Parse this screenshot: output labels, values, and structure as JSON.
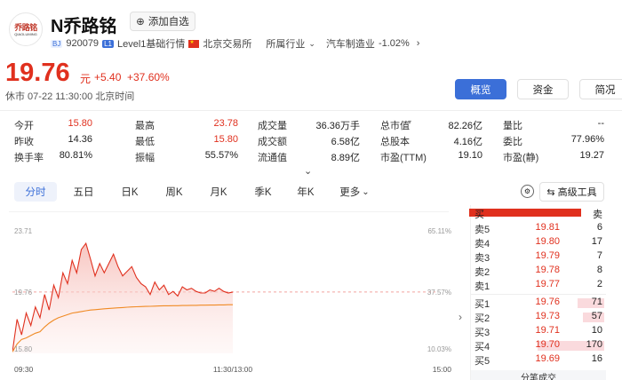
{
  "header": {
    "logo_text_cn": "乔路铭",
    "logo_text_en": "QIAOLUMING",
    "stock_name": "N乔路铭",
    "watch_label": "添加自选",
    "exchange_tag": "BJ",
    "code": "920079",
    "level_tag": "L1",
    "level_label": "Level1基础行情",
    "exchange_name": "北京交易所",
    "industry_label": "所属行业",
    "industry_name": "汽车制造业",
    "industry_change": "-1.02%"
  },
  "quote": {
    "price": "19.76",
    "unit": "元",
    "change": "+5.40",
    "change_pct": "+37.60%",
    "status": "休市 07-22 11:30:00 北京时间"
  },
  "tabs": [
    "概览",
    "资金",
    "简况"
  ],
  "stats": [
    [
      {
        "label": "今开",
        "value": "15.80",
        "color": "red"
      },
      {
        "label": "最高",
        "value": "23.78",
        "color": "red"
      },
      {
        "label": "成交量",
        "value": "36.36万手",
        "color": ""
      },
      {
        "label": "总市值",
        "value": "82.26亿",
        "color": "",
        "has_arrow": true
      },
      {
        "label": "量比",
        "value": "--",
        "color": ""
      }
    ],
    [
      {
        "label": "昨收",
        "value": "14.36",
        "color": ""
      },
      {
        "label": "最低",
        "value": "15.80",
        "color": "red"
      },
      {
        "label": "成交额",
        "value": "6.58亿",
        "color": ""
      },
      {
        "label": "总股本",
        "value": "4.16亿",
        "color": ""
      },
      {
        "label": "委比",
        "value": "77.96%",
        "color": ""
      }
    ],
    [
      {
        "label": "换手率",
        "value": "80.81%",
        "color": ""
      },
      {
        "label": "振幅",
        "value": "55.57%",
        "color": ""
      },
      {
        "label": "流通值",
        "value": "8.89亿",
        "color": ""
      },
      {
        "label": "市盈(TTM)",
        "value": "19.10",
        "color": ""
      },
      {
        "label": "市盈(静)",
        "value": "19.27",
        "color": ""
      }
    ]
  ],
  "periods": [
    "分时",
    "五日",
    "日K",
    "周K",
    "月K",
    "季K",
    "年K",
    "更多"
  ],
  "tools_label": "高级工具",
  "chart_data": {
    "type": "line",
    "title": "",
    "y_left_labels": [
      "23.71",
      "19.76",
      "15.80"
    ],
    "y_right_labels": [
      "65.11%",
      "37.57%",
      "10.03%"
    ],
    "x_labels": [
      "09:30",
      "11:30/13:00",
      "15:00"
    ],
    "ylim": [
      15.8,
      23.71
    ],
    "prev_close_ref": 19.76,
    "series": [
      {
        "color": "#e0301e",
        "values": [
          15.9,
          18.0,
          17.0,
          18.4,
          17.6,
          18.8,
          18.1,
          19.6,
          18.6,
          20.2,
          19.4,
          21.0,
          20.3,
          21.8,
          21.0,
          22.5,
          22.9,
          21.9,
          20.8,
          21.6,
          21.0,
          21.6,
          22.2,
          21.4,
          20.8,
          21.1,
          21.4,
          20.7,
          20.3,
          20.1,
          19.6,
          20.4,
          19.9,
          20.2,
          19.6,
          19.8,
          19.5,
          20.1,
          19.9,
          20.0,
          19.8,
          19.7,
          19.7,
          19.9,
          19.8,
          20.0,
          19.8,
          19.7,
          19.76
        ]
      },
      {
        "color": "#f08a24",
        "values": [
          15.9,
          16.4,
          16.7,
          16.8,
          16.95,
          17.1,
          17.2,
          17.5,
          17.75,
          17.95,
          18.1,
          18.2,
          18.3,
          18.4,
          18.45,
          18.5,
          18.55,
          18.6,
          18.62,
          18.65,
          18.68,
          18.7,
          18.72,
          18.74,
          18.76,
          18.78,
          18.8,
          18.81,
          18.82,
          18.83,
          18.84,
          18.85,
          18.86,
          18.87,
          18.87,
          18.88,
          18.88,
          18.89,
          18.89,
          18.9,
          18.9,
          18.91,
          18.91,
          18.92,
          18.92,
          18.93,
          18.93,
          18.94,
          18.94
        ]
      }
    ]
  },
  "orderbook": {
    "ratio_left": "买",
    "ratio_right": "卖",
    "ratio_buy_pct": 0.9,
    "asks": [
      {
        "label": "卖5",
        "price": "19.81",
        "vol": "6"
      },
      {
        "label": "卖4",
        "price": "19.80",
        "vol": "17"
      },
      {
        "label": "卖3",
        "price": "19.79",
        "vol": "7"
      },
      {
        "label": "卖2",
        "price": "19.78",
        "vol": "8"
      },
      {
        "label": "卖1",
        "price": "19.77",
        "vol": "2"
      }
    ],
    "bids": [
      {
        "label": "买1",
        "price": "19.76",
        "vol": "71",
        "bar": 0.2
      },
      {
        "label": "买2",
        "price": "19.73",
        "vol": "57",
        "bar": 0.16
      },
      {
        "label": "买3",
        "price": "19.71",
        "vol": "10",
        "bar": 0
      },
      {
        "label": "买4",
        "price": "19.70",
        "vol": "170",
        "bar": 0.5
      },
      {
        "label": "买5",
        "price": "19.69",
        "vol": "16",
        "bar": 0
      }
    ],
    "footer": "分笔成交"
  },
  "colors": {
    "up": "#e0301e",
    "down": "#1a9e5a",
    "accent": "#3b6fd8"
  }
}
